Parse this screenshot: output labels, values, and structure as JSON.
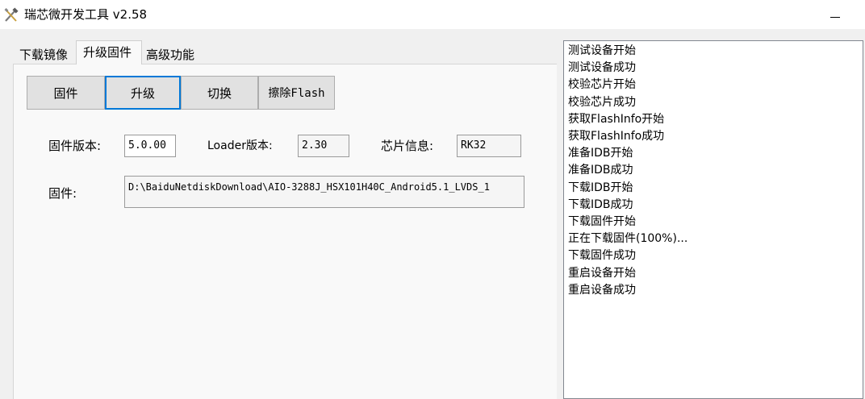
{
  "window": {
    "title": "瑞芯微开发工具 v2.58",
    "icon": "tools-icon",
    "minimize_icon": "minimize-icon"
  },
  "tabs": [
    {
      "label": "下载镜像",
      "selected": false
    },
    {
      "label": "升级固件",
      "selected": true
    },
    {
      "label": "高级功能",
      "selected": false
    }
  ],
  "buttons": {
    "firmware": "固件",
    "upgrade": "升级",
    "switch": "切换",
    "erase_flash": "擦除Flash"
  },
  "fields": {
    "firmware_version_label": "固件版本:",
    "firmware_version_value": "5.0.00",
    "loader_version_label": "Loader版本:",
    "loader_version_value": "2.30",
    "chip_info_label": "芯片信息:",
    "chip_info_value": "RK32",
    "firmware_label": "固件:",
    "firmware_path": "D:\\BaiduNetdiskDownload\\AIO-3288J_HSX101H40C_Android5.1_LVDS_1"
  },
  "log": [
    "测试设备开始",
    "测试设备成功",
    "校验芯片开始",
    "校验芯片成功",
    "获取FlashInfo开始",
    "获取FlashInfo成功",
    "准备IDB开始",
    "准备IDB成功",
    "下载IDB开始",
    "下载IDB成功",
    "下载固件开始",
    "正在下载固件(100%)...",
    "下载固件成功",
    "重启设备开始",
    "重启设备成功"
  ],
  "colors": {
    "focus_border": "#0078d7",
    "window_bg": "#f0f0f0",
    "panel_bg": "#f9f9f9"
  }
}
